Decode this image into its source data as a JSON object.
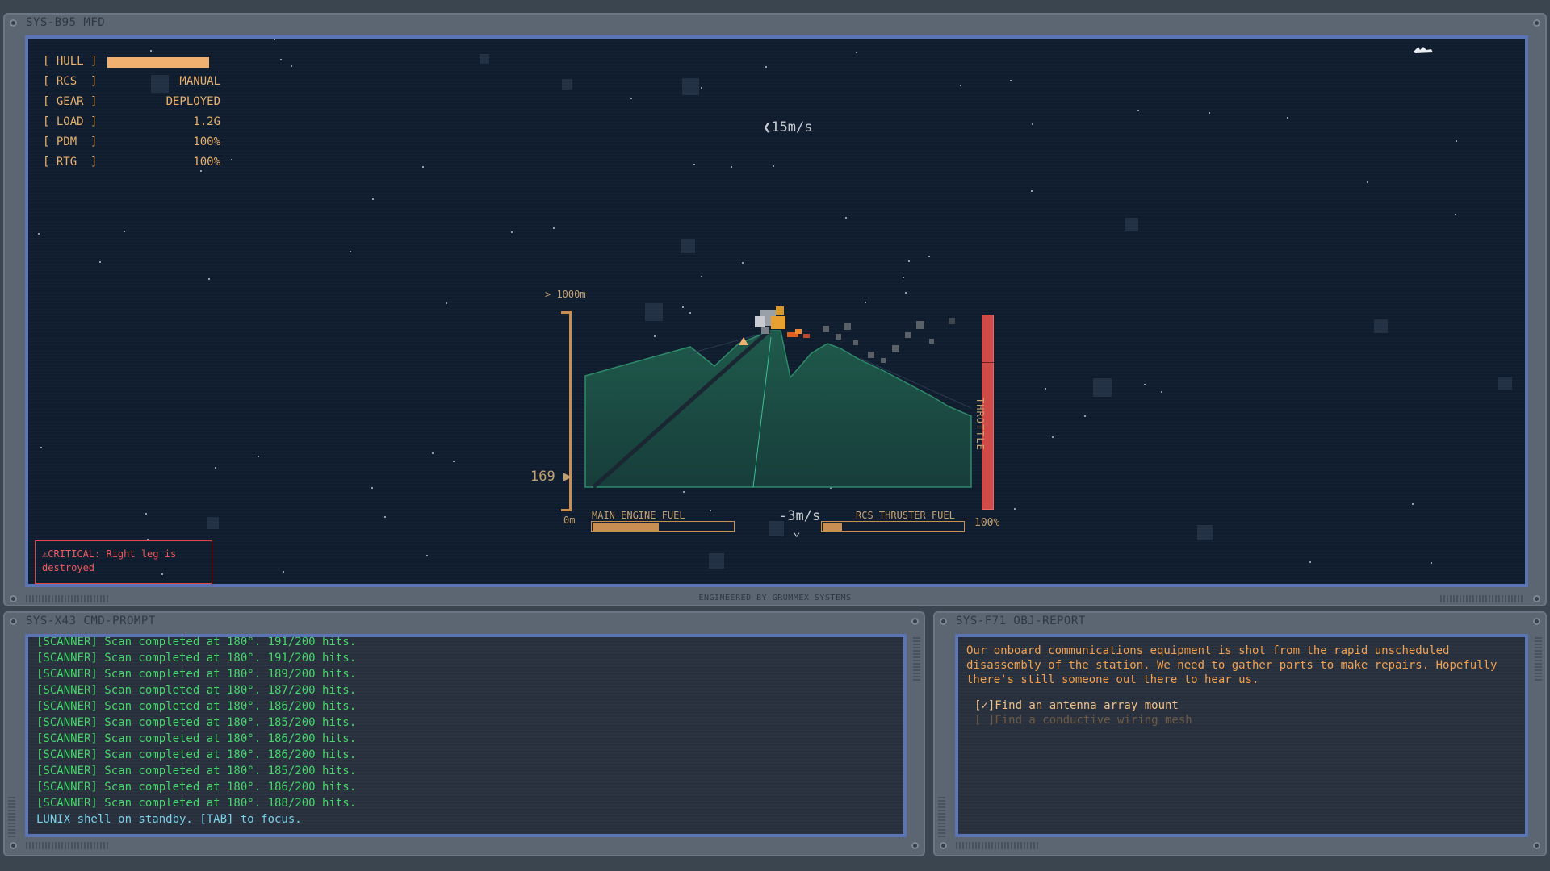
{
  "mfd": {
    "title": "SYS-B95 MFD",
    "footer": "ENGINEERED BY GRUMMEX SYSTEMS",
    "status": [
      {
        "label": "[ HULL ]",
        "value": ""
      },
      {
        "label": "[ RCS  ]",
        "value": "MANUAL"
      },
      {
        "label": "[ GEAR ]",
        "value": "DEPLOYED"
      },
      {
        "label": "[ LOAD ]",
        "value": "1.2G"
      },
      {
        "label": "[ PDM  ]",
        "value": "100%"
      },
      {
        "label": "[ RTG  ]",
        "value": "100%"
      }
    ],
    "hull_level": 1.0,
    "horizontal_speed": "15m/s",
    "vertical_speed": "-3m/s",
    "altitude": {
      "top": "> 1000m",
      "bottom": "0m",
      "value": "169"
    },
    "throttle": {
      "label": "THROTTLE",
      "percent": "100%",
      "level": 1.0
    },
    "main_fuel": {
      "label": "MAIN ENGINE FUEL",
      "level": 0.47
    },
    "rcs_fuel": {
      "label": "RCS THRUSTER FUEL",
      "level": 0.14
    },
    "critical": "⚠CRITICAL: Right leg is destroyed",
    "colors": {
      "accent": "#e8b06c",
      "critical": "#e04848",
      "terrain": "#1b4a42",
      "throttle": "#d04a48"
    }
  },
  "cmd": {
    "title": "SYS-X43 CMD-PROMPT",
    "lines": [
      "[SCANNER] Scan completed at 180°. 191/200 hits.",
      "[SCANNER] Scan completed at 180°. 191/200 hits.",
      "[SCANNER] Scan completed at 180°. 189/200 hits.",
      "[SCANNER] Scan completed at 180°. 187/200 hits.",
      "[SCANNER] Scan completed at 180°. 186/200 hits.",
      "[SCANNER] Scan completed at 180°. 185/200 hits.",
      "[SCANNER] Scan completed at 180°. 186/200 hits.",
      "[SCANNER] Scan completed at 180°. 186/200 hits.",
      "[SCANNER] Scan completed at 180°. 185/200 hits.",
      "[SCANNER] Scan completed at 180°. 186/200 hits.",
      "[SCANNER] Scan completed at 180°. 188/200 hits."
    ],
    "standby": "LUNIX shell on standby. [TAB] to focus."
  },
  "obj": {
    "title": "SYS-F71 OBJ-REPORT",
    "text": "Our onboard communications equipment is shot from the rapid unscheduled disassembly of the station. We need to gather parts to make repairs. Hopefully there's still someone out there to hear us.",
    "items": [
      {
        "label": "[✓]Find an antenna array mount",
        "done": true
      },
      {
        "label": "[ ]Find a conductive wiring mesh",
        "done": false
      }
    ]
  }
}
